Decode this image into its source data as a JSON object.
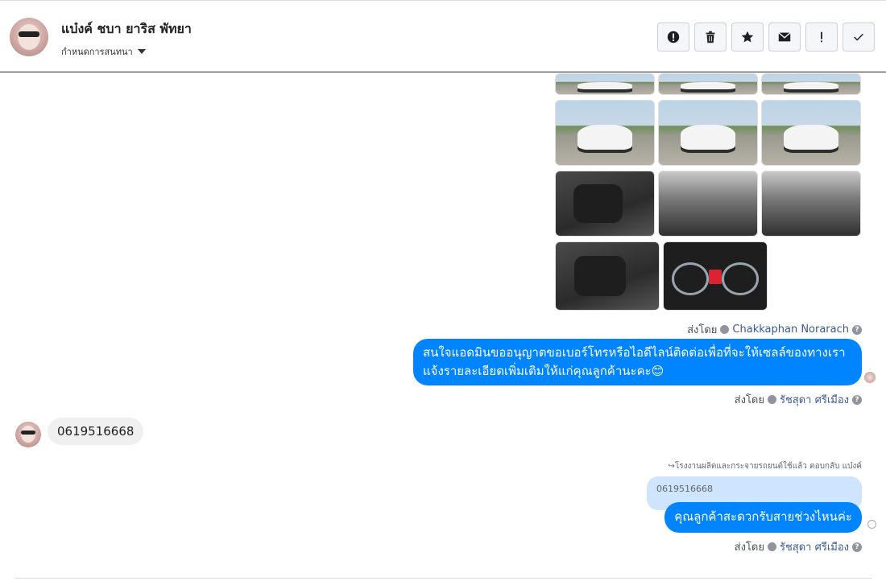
{
  "header": {
    "contact_name": "แบ๋งค์ ชบา ยาริส พัทยา",
    "label_menu": "กำหนดการสนทนา"
  },
  "toolbar": {
    "buttons": [
      "alert-circle-icon",
      "trash-icon",
      "star-icon",
      "envelope-icon",
      "exclamation-icon",
      "check-icon"
    ]
  },
  "messages": {
    "sent_by_1": {
      "prefix": "ส่งโดย",
      "name": "Chakkaphan Norarach"
    },
    "bubble_1_line1": "สนใจแอดมินขออนุญาตขอเบอร์โทรหรือไอดีไลน์ติดต่อเพื่อที่จะให้เซลล์ของทางเรา",
    "bubble_1_line2": "แจ้งรายละเอียดเพิ่มเติมให้แก่คุณลูกค้านะคะ😊",
    "sent_by_2": {
      "prefix": "ส่งโดย",
      "name": "รัชสุดา ศรีเมือง"
    },
    "incoming_phone": "0619516668",
    "reply_note": "โรงงานผลิตและกระจายรถยนต์ใช้แล้ว ตอบกลับ แบ๋งค์",
    "quoted_text": "0619516668",
    "bubble_2": "คุณลูกค้าสะดวกรับสายช่วงไหนค่ะ",
    "sent_by_3": {
      "prefix": "ส่งโดย",
      "name": "รัชสุดา ศรีเมือง"
    }
  },
  "colors": {
    "accent": "#0084ff",
    "quote_bg": "#cfe4fd",
    "incoming_bg": "#f1f0f0"
  }
}
